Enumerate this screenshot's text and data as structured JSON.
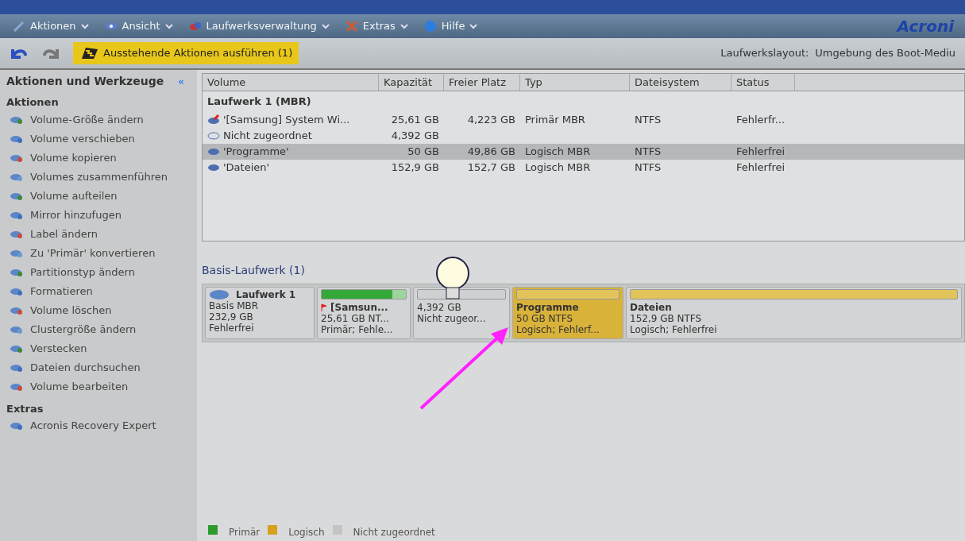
{
  "menu": [
    {
      "label": "Aktionen"
    },
    {
      "label": "Ansicht"
    },
    {
      "label": "Laufwerksverwaltung"
    },
    {
      "label": "Extras"
    },
    {
      "label": "Hilfe"
    }
  ],
  "logo": "Acroni",
  "toolbar": {
    "commit_button": "Ausstehende Aktionen ausführen (1)",
    "layout_label": "Laufwerkslayout:",
    "layout_value": "Umgebung des Boot-Mediu"
  },
  "sidebar": {
    "title": "Aktionen und Werkzeuge",
    "collapse": "«",
    "sections": [
      {
        "title": "Aktionen",
        "items": [
          "Volume-Größe ändern",
          "Volume verschieben",
          "Volume kopieren",
          "Volumes zusammenführen",
          "Volume aufteilen",
          "Mirror hinzufugen",
          "Label ändern",
          "Zu 'Primär' konvertieren",
          "Partitionstyp ändern",
          "Formatieren",
          "Volume löschen",
          "Clustergröße ändern",
          "Verstecken",
          "Dateien durchsuchen",
          "Volume bearbeiten"
        ]
      },
      {
        "title": "Extras",
        "items": [
          "Acronis Recovery Expert"
        ]
      }
    ]
  },
  "table": {
    "columns": [
      "Volume",
      "Kapazität",
      "Freier Platz",
      "Typ",
      "Dateisystem",
      "Status"
    ],
    "group": "Laufwerk 1 (MBR)",
    "rows": [
      {
        "kind": "system",
        "selected": false,
        "cells": [
          "'[Samsung] System Wi...",
          "25,61 GB",
          "4,223 GB",
          "Primär MBR",
          "NTFS",
          "Fehlerfr..."
        ]
      },
      {
        "kind": "unallocated",
        "selected": false,
        "cells": [
          "Nicht zugeordnet",
          "4,392 GB",
          "",
          "",
          "",
          ""
        ]
      },
      {
        "kind": "logical",
        "selected": true,
        "cells": [
          "'Programme'",
          "50 GB",
          "49,86 GB",
          "Logisch MBR",
          "NTFS",
          "Fehlerfrei"
        ]
      },
      {
        "kind": "logical",
        "selected": false,
        "cells": [
          "'Dateien'",
          "152,9 GB",
          "152,7 GB",
          "Logisch MBR",
          "NTFS",
          "Fehlerfrei"
        ]
      }
    ]
  },
  "disk_section": {
    "title": "Basis-Laufwerk (1)",
    "disk": {
      "name": "Laufwerk 1",
      "lines": [
        "Basis MBR",
        "232,9 GB",
        "Fehlerfrei"
      ]
    },
    "partitions": [
      {
        "kind": "primary",
        "selected": false,
        "flag": true,
        "name": "[Samsun...",
        "size": "25,61 GB NT...",
        "info": "Primär; Fehle...",
        "level": 0.84
      },
      {
        "kind": "unallocated",
        "selected": false,
        "size": "4,392 GB",
        "info": "Nicht zugeor..."
      },
      {
        "kind": "logical",
        "selected": true,
        "flag": false,
        "name": "Programme",
        "size": "50 GB NTFS",
        "info": "Logisch; Fehlerf..."
      },
      {
        "kind": "logical",
        "selected": false,
        "flag": false,
        "name": "Dateien",
        "size": "152,9 GB NTFS",
        "info": "Logisch; Fehlerfrei"
      }
    ]
  },
  "legend": [
    {
      "label": "Primär",
      "color": "#2e9a2e"
    },
    {
      "label": "Logisch",
      "color": "#d6a21c"
    },
    {
      "label": "Nicht zugeordnet",
      "color": "#c4c4c4"
    }
  ]
}
